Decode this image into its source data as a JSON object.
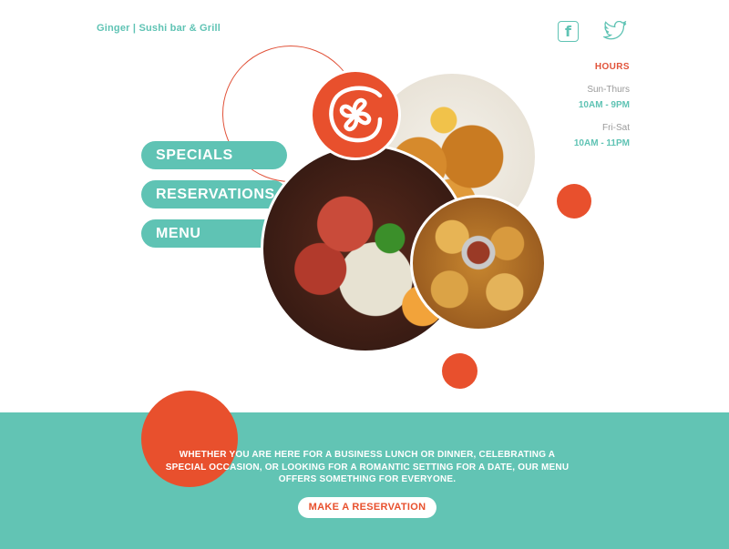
{
  "brand": {
    "name": "Ginger | Sushi bar & Grill"
  },
  "social": {
    "facebook_icon": "facebook-icon",
    "twitter_icon": "twitter-icon"
  },
  "hours": {
    "title": "HOURS",
    "schedule": [
      {
        "days": "Sun-Thurs",
        "time": "10AM - 9PM"
      },
      {
        "days": "Fri-Sat",
        "time": "10AM - 11PM"
      }
    ]
  },
  "nav": {
    "items": [
      "SPECIALS",
      "RESERVATIONS",
      "MENU"
    ]
  },
  "tagline": "WHETHER YOU ARE HERE FOR A BUSINESS LUNCH OR DINNER, CELEBRATING A SPECIAL OCCASION, OR LOOKING FOR A ROMANTIC SETTING FOR A DATE, OUR MENU OFFERS SOMETHING FOR EVERYONE.",
  "cta": {
    "label": "MAKE A RESERVATION"
  },
  "colors": {
    "teal": "#5fc3b4",
    "orange": "#e8502d",
    "hours_title": "#e1533a"
  }
}
